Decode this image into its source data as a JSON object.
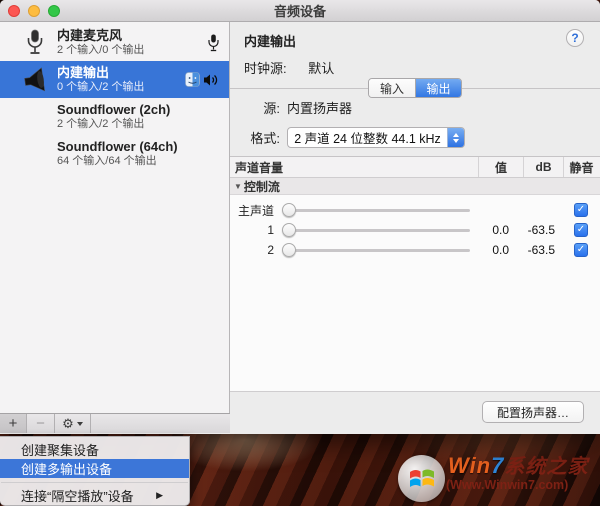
{
  "window": {
    "title": "音频设备"
  },
  "sidebar": {
    "devices": [
      {
        "name": "内建麦克风",
        "detail": "2 个输入/0 个输出"
      },
      {
        "name": "内建输出",
        "detail": "0 个输入/2 个输出"
      },
      {
        "name": "Soundflower (2ch)",
        "detail": "2 个输入/2 个输出"
      },
      {
        "name": "Soundflower (64ch)",
        "detail": "64 个输入/64 个输出"
      }
    ],
    "toolbar": {
      "add": "+",
      "remove": "−"
    }
  },
  "panel": {
    "device_title": "内建输出",
    "help_label": "?",
    "clock_label": "时钟源:",
    "clock_value": "默认",
    "tabs": {
      "input": "输入",
      "output": "输出"
    },
    "source_label": "源:",
    "source_value": "内置扬声器",
    "format_label": "格式:",
    "format_value": "2 声道 24 位整数 44.1 kHz",
    "table": {
      "col_channel": "声道音量",
      "col_value": "值",
      "col_db": "dB",
      "col_mute": "静音",
      "group_label": "控制流",
      "rows": [
        {
          "label": "主声道",
          "value": "",
          "db": ""
        },
        {
          "label": "1",
          "value": "0.0",
          "db": "-63.5"
        },
        {
          "label": "2",
          "value": "0.0",
          "db": "-63.5"
        }
      ]
    },
    "configure_button": "配置扬声器…"
  },
  "context_menu": {
    "items": [
      {
        "label": "创建聚集设备"
      },
      {
        "label": "创建多输出设备"
      },
      {
        "label": "连接“隔空播放”设备"
      }
    ]
  },
  "watermark": {
    "brand_win": "Win",
    "brand_seven": "7",
    "brand_suffix": "系统之家",
    "url": "(Www.Winwin7.com)"
  },
  "colors": {
    "selection_blue": "#3875d7",
    "accent_blue": "#2e72e2"
  }
}
